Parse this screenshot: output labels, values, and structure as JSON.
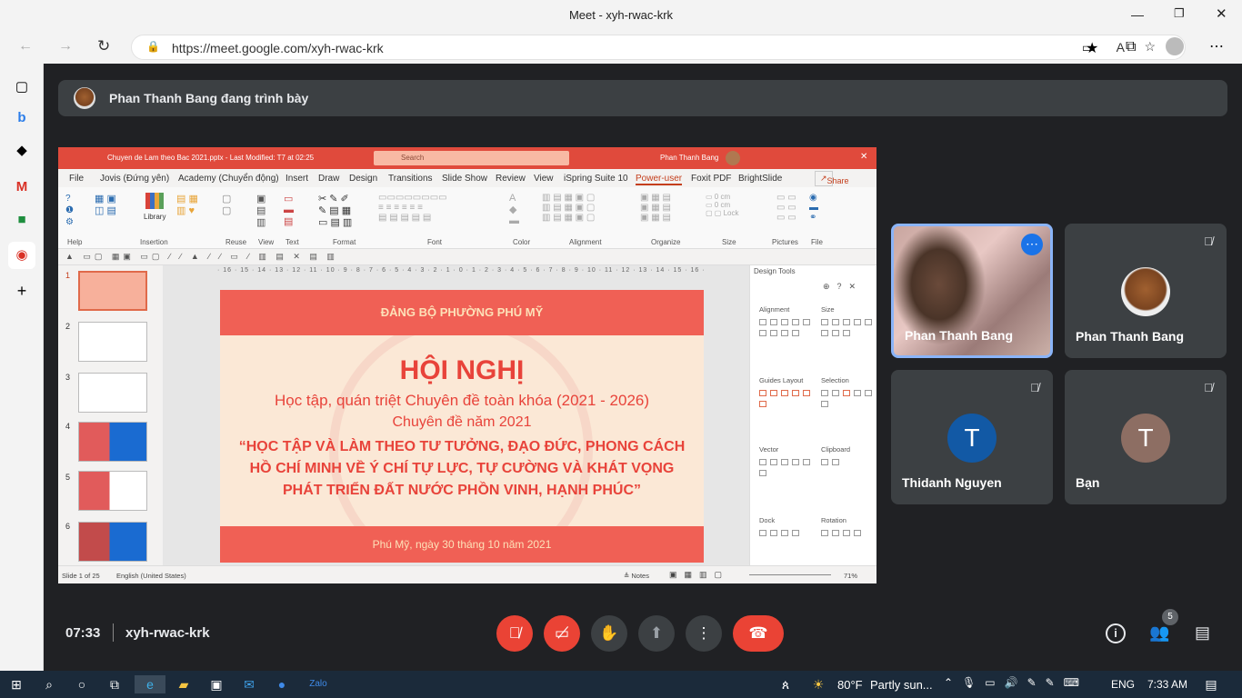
{
  "window": {
    "title": "Meet - xyh-rwac-krk"
  },
  "browser": {
    "url": "https://meet.google.com/xyh-rwac-krk"
  },
  "banner": {
    "text": "Phan Thanh Bang đang trình bày"
  },
  "ppt": {
    "filename": "Chuyen de Lam theo Bac 2021.pptx - Last Modified: T7 at 02:25",
    "search": "Search",
    "user": "Phan Thanh Bang",
    "share": "Share",
    "menu": [
      "File",
      "Jovis (Đứng yên)",
      "Academy (Chuyển động)",
      "Insert",
      "Draw",
      "Design",
      "Transitions",
      "Slide Show",
      "Review",
      "View",
      "iSpring Suite 10",
      "Power-user",
      "Foxit PDF",
      "BrightSlide"
    ],
    "groups": [
      "Help",
      "Insertion",
      "Reuse",
      "View",
      "Text",
      "Format",
      "Font",
      "Color",
      "Alignment",
      "Organize",
      "Size",
      "Pictures",
      "File"
    ],
    "library": "Library",
    "lock": "Lock",
    "slide": {
      "header": "ĐẢNG BỘ PHƯỜNG PHÚ MỸ",
      "title": "HỘI NGHỊ",
      "line1": "Học tập, quán triệt Chuyên đề toàn khóa (2021 - 2026)",
      "line2": "Chuyên đề năm 2021",
      "q1": "“HỌC TẬP VÀ LÀM THEO TƯ TƯỞNG, ĐẠO ĐỨC, PHONG CÁCH",
      "q2": "HỒ CHÍ MINH VỀ Ý CHÍ TỰ LỰC, TỰ CƯỜNG VÀ KHÁT VỌNG",
      "q3": "PHÁT TRIỂN ĐẤT NƯỚC PHỒN VINH, HẠNH PHÚC”",
      "footer": "Phú Mỹ, ngày 30 tháng 10 năm 2021"
    },
    "design_tools": {
      "title": "Design Tools",
      "sections": [
        "Alignment",
        "Size",
        "Guides Layout",
        "Selection",
        "Vector",
        "Clipboard",
        "Dock",
        "Rotation"
      ]
    },
    "status": {
      "slide": "Slide 1 of 25",
      "lang": "English (United States)",
      "notes": "Notes",
      "zoom": "71%"
    }
  },
  "tiles": [
    {
      "name": "Phan Thanh Bang"
    },
    {
      "name": "Phan Thanh Bang"
    },
    {
      "name": "Thidanh Nguyen",
      "letter": "T",
      "color": "#1259a5"
    },
    {
      "name": "Bạn",
      "letter": "T",
      "color": "#8d6e63"
    }
  ],
  "meeting": {
    "time": "07:33",
    "code": "xyh-rwac-krk",
    "participants": "5"
  },
  "taskbar": {
    "weather": "80°F",
    "condition": "Partly sun...",
    "lang": "ENG",
    "clock": "7:33 AM"
  }
}
